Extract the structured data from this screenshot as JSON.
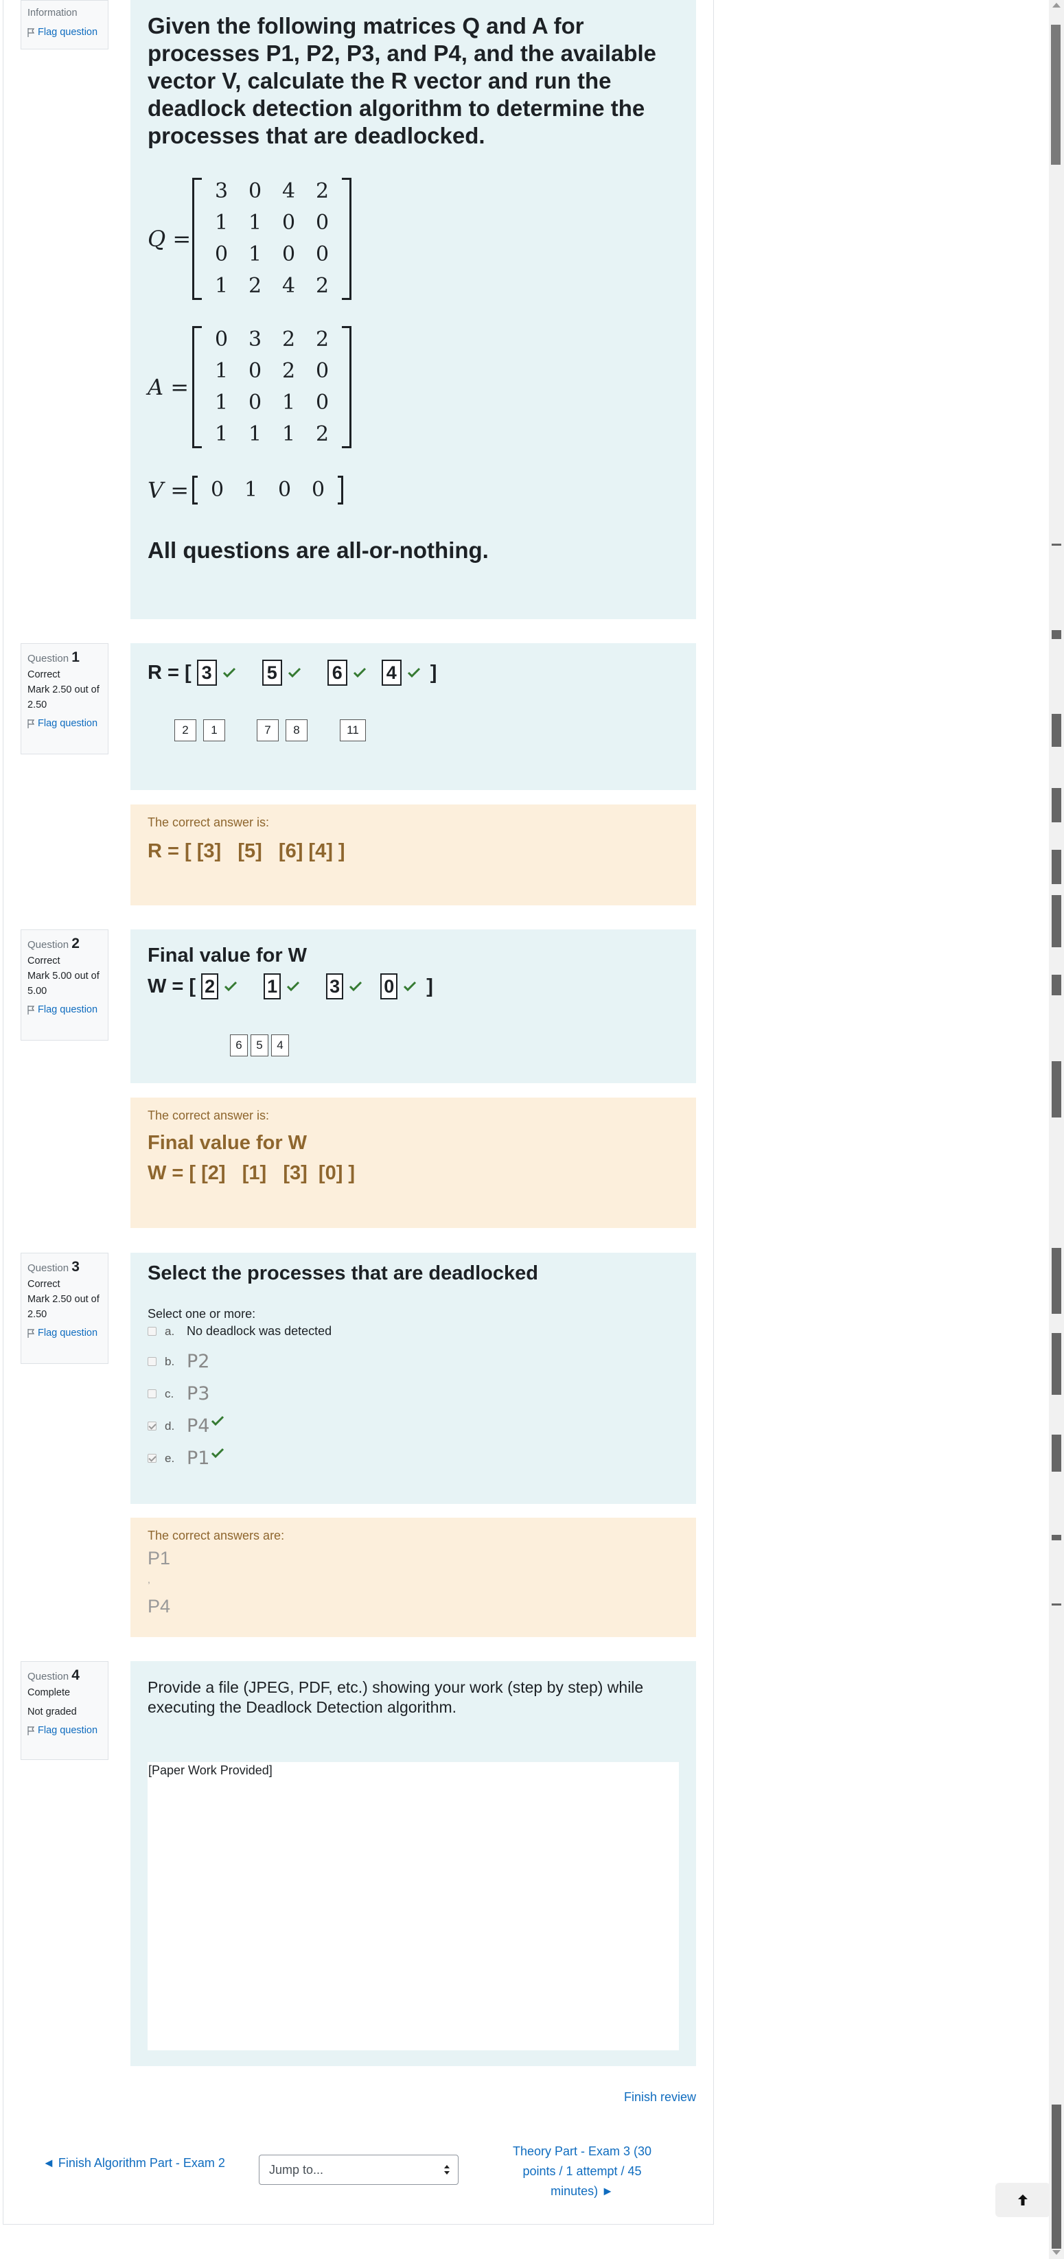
{
  "info_block": {
    "label": "Information",
    "flag": "Flag question"
  },
  "intro": {
    "heading": "Given the following matrices Q and A for processes P1, P2, P3, and P4, and the available vector V, calculate the R vector and run the deadlock detection algorithm to determine the processes that are deadlocked.",
    "q_label": "Q =",
    "q_matrix": [
      "3",
      "0",
      "4",
      "2",
      "1",
      "1",
      "0",
      "0",
      "0",
      "1",
      "0",
      "0",
      "1",
      "2",
      "4",
      "2"
    ],
    "a_label": "A =",
    "a_matrix": [
      "0",
      "3",
      "2",
      "2",
      "1",
      "0",
      "2",
      "0",
      "1",
      "0",
      "1",
      "0",
      "1",
      "1",
      "1",
      "2"
    ],
    "v_label": "V =",
    "v_vector": [
      "0",
      "1",
      "0",
      "0"
    ],
    "note": "All questions are all-or-nothing."
  },
  "q1": {
    "label": "Question",
    "num": "1",
    "state": "Correct",
    "grade": "Mark 2.50 out of 2.50",
    "flag": "Flag question",
    "prefix": "R = [",
    "suffix": "]",
    "answers": [
      "3",
      "5",
      "6",
      "4"
    ],
    "drags": [
      "2",
      "1",
      "7",
      "8",
      "11"
    ],
    "fb_label": "The correct answer is:",
    "fb_text": "R = [ [3]   [5]   [6] [4] ]"
  },
  "q2": {
    "label": "Question",
    "num": "2",
    "state": "Correct",
    "grade": "Mark 5.00 out of 5.00",
    "flag": "Flag question",
    "title": "Final value for W",
    "prefix": "W = [",
    "suffix": "]",
    "answers": [
      "2",
      "1",
      "3",
      "0"
    ],
    "drags": [
      "6",
      "5",
      "4"
    ],
    "fb_label": "The correct answer is:",
    "fb_title": "Final value for W",
    "fb_text": "W = [ [2]   [1]   [3]  [0] ]"
  },
  "q3": {
    "label": "Question",
    "num": "3",
    "state": "Correct",
    "grade": "Mark 2.50 out of 2.50",
    "flag": "Flag question",
    "title": "Select the processes that are deadlocked",
    "prompt": "Select one or more:",
    "options": [
      {
        "letter": "a.",
        "text": "No deadlock was detected",
        "checked": false
      },
      {
        "letter": "b.",
        "text": "P2",
        "checked": false
      },
      {
        "letter": "c.",
        "text": "P3",
        "checked": false
      },
      {
        "letter": "d.",
        "text": "P4",
        "checked": true
      },
      {
        "letter": "e.",
        "text": "P1",
        "checked": true
      }
    ],
    "fb_label": "The correct answers are:",
    "fb_answers": [
      "P1",
      ",",
      "P4"
    ]
  },
  "q4": {
    "label": "Question",
    "num": "4",
    "state": "Complete",
    "grade": "Not graded",
    "flag": "Flag question",
    "prompt": "Provide a file (JPEG, PDF, etc.) showing your work (step by step) while executing the Deadlock Detection algorithm.",
    "response": "[Paper Work Provided]"
  },
  "footer": {
    "finish_review": "Finish review",
    "prev_link": "◄ Finish Algorithm Part - Exam 2",
    "jump_placeholder": "Jump to...",
    "next_link": "Theory Part - Exam 3 (30 points / 1 attempt / 45 minutes) ►",
    "top_icon": "arrow-up-icon"
  },
  "colors": {
    "accent": "#0f6cbf",
    "content_bg": "#e7f3f5",
    "feedback_bg": "#fcefdc",
    "feedback_text": "#8e662e",
    "check": "#357a32"
  }
}
